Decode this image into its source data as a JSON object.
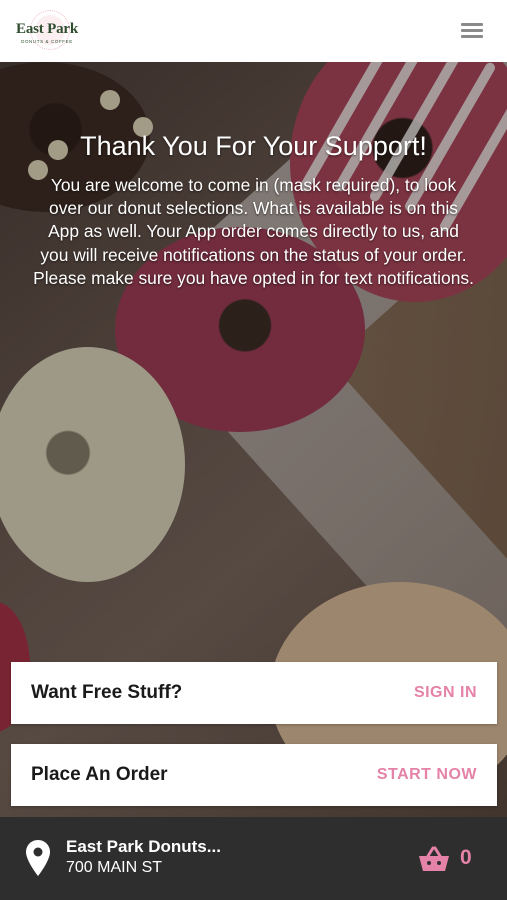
{
  "header": {
    "logo_name": "East Park",
    "logo_subtitle": "DONUTS & COFFEE",
    "menu_icon": "hamburger-menu-icon"
  },
  "message": {
    "title": "Thank You For Your Support!",
    "lines": [
      "You are welcome to come in (mask required), to look",
      "over our donut selections.  What is available is on this",
      "App as well.   Your App order comes directly to us, and",
      "you will receive notifications on the status of your order.",
      "Please make sure you have opted in for text notifications."
    ]
  },
  "cards": {
    "free": {
      "label": "Want Free Stuff?",
      "action": "SIGN IN"
    },
    "order": {
      "label": "Place An Order",
      "action": "START NOW"
    }
  },
  "footer": {
    "store_name": "East Park Donuts...",
    "store_address": "700 MAIN ST",
    "cart_count": "0",
    "location_icon": "location-pin-icon",
    "cart_icon": "basket-icon"
  },
  "colors": {
    "accent": "#e582a7",
    "footer_bg": "#2e2e2e",
    "logo_green": "#2f4d2f"
  }
}
